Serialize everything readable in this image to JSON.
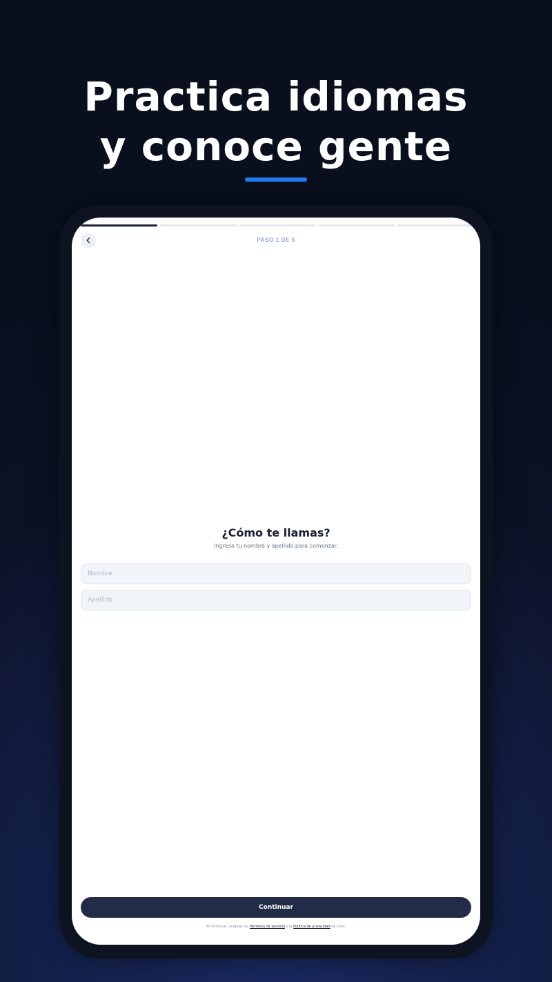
{
  "hero": {
    "title_line1": "Practica idiomas",
    "title_line2": "y conoce gente"
  },
  "colors": {
    "accent": "#1e7ef0",
    "button": "#232c47",
    "step_label": "#8e9cc2"
  },
  "progress": {
    "total_steps": 5,
    "current_step": 1
  },
  "header": {
    "back_icon": "chevron-left-icon",
    "step_label": "PASO 1 DE 5"
  },
  "form": {
    "question": "¿Cómo te llamas?",
    "subtitle": "Ingresa tu nombre y apellido para comenzar.",
    "first_name": {
      "placeholder": "Nombre",
      "value": ""
    },
    "last_name": {
      "placeholder": "Apellido",
      "value": ""
    }
  },
  "footer": {
    "continue_label": "Continuar",
    "legal_prefix": "Al continuar, aceptas los",
    "terms_link": "Términos de servicio",
    "legal_and": "y la",
    "privacy_link": "Política de privacidad",
    "legal_suffix": "de Drex."
  }
}
